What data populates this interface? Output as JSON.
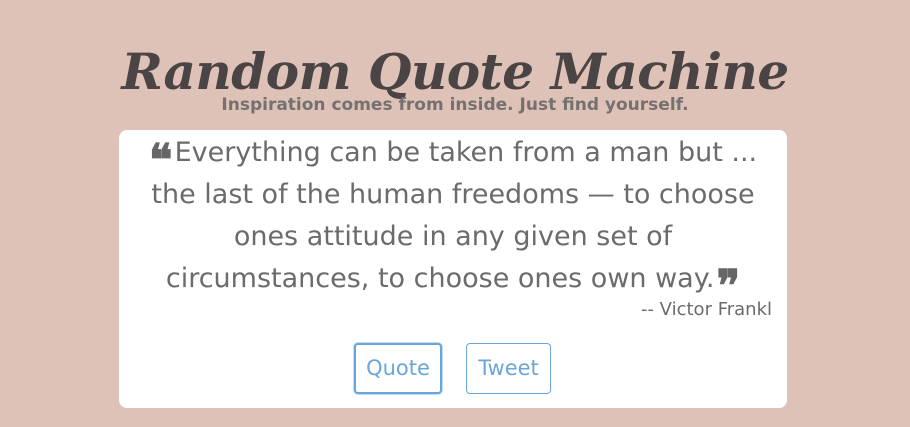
{
  "header": {
    "title": "Random Quote Machine",
    "subtitle": "Inspiration comes from inside. Just find yourself."
  },
  "quote": {
    "open_icon": "quote-left-icon",
    "text": "Everything can be taken from a man but ... the last of the human freedoms — to choose ones attitude in any given set of circumstances, to choose ones own way.",
    "close_icon": "quote-right-icon",
    "author": "-- Victor Frankl"
  },
  "buttons": {
    "quote_label": "Quote",
    "tweet_label": "Tweet"
  },
  "colors": {
    "background": "#dfc2b7",
    "card": "#ffffff",
    "accent": "#6aa6dc",
    "title": "#4a4444"
  }
}
